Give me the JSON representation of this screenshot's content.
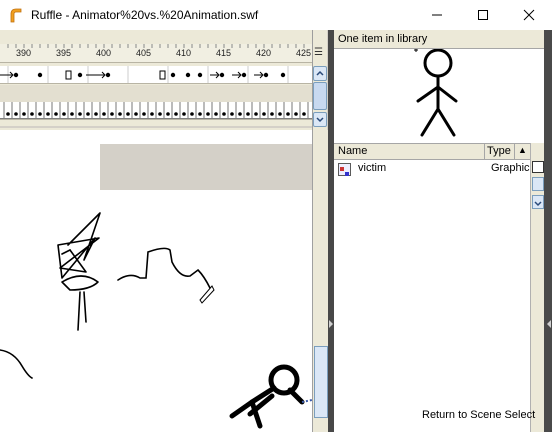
{
  "window": {
    "title": "Ruffle - Animator%20vs.%20Animation.swf",
    "icon": "ruffle-logo-icon",
    "controls": [
      "minimize-icon",
      "maximize-icon",
      "close-icon"
    ]
  },
  "timeline": {
    "frame_ticks": [
      "390",
      "395",
      "400",
      "405",
      "410",
      "415",
      "420",
      "425"
    ],
    "menu_icon": "timeline-menu-icon"
  },
  "library": {
    "item_count": "One item in library",
    "columns": {
      "name": "Name",
      "type": "Type"
    },
    "items": [
      {
        "name": "victim",
        "type": "Graphic",
        "icon": "graphic-symbol-icon"
      }
    ]
  },
  "stage": {
    "return_link": "Return to Scene Select"
  },
  "colors": {
    "panel": "#ece9d8",
    "stage_gray": "#d4d0c8",
    "divider": "#484848",
    "scroll_accent": "#7b9ebd"
  }
}
